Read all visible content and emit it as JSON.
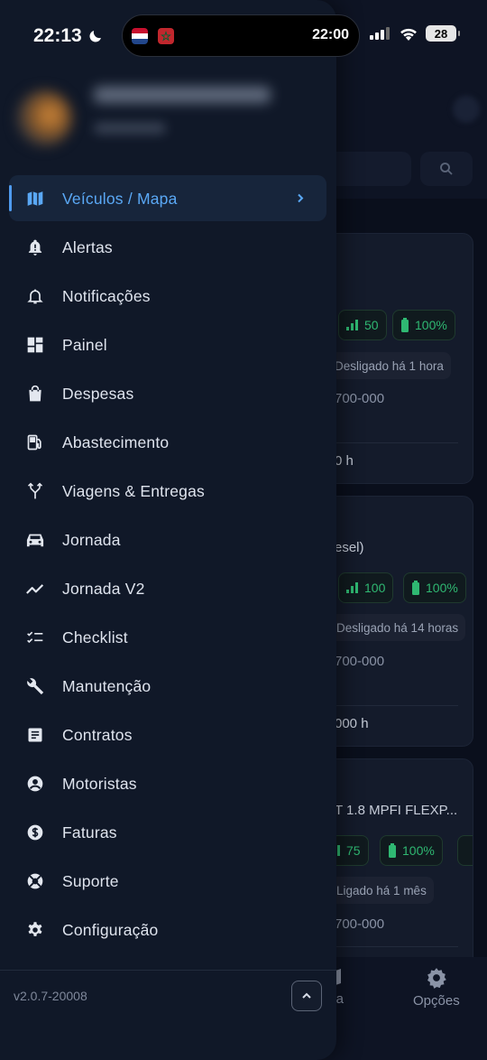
{
  "status_bar": {
    "time": "22:13",
    "island_time": "22:00",
    "battery": "28"
  },
  "drawer": {
    "menu": [
      {
        "label": "Veículos / Mapa",
        "icon": "map-icon",
        "active": true
      },
      {
        "label": "Alertas",
        "icon": "bell-alert-icon"
      },
      {
        "label": "Notificações",
        "icon": "bell-outline-icon"
      },
      {
        "label": "Painel",
        "icon": "dashboard-icon"
      },
      {
        "label": "Despesas",
        "icon": "shopping-bag-icon"
      },
      {
        "label": "Abastecimento",
        "icon": "fuel-pump-icon"
      },
      {
        "label": "Viagens & Entregas",
        "icon": "route-fork-icon"
      },
      {
        "label": "Jornada",
        "icon": "car-icon"
      },
      {
        "label": "Jornada V2",
        "icon": "trend-line-icon"
      },
      {
        "label": "Checklist",
        "icon": "checklist-icon"
      },
      {
        "label": "Manutenção",
        "icon": "wrench-icon"
      },
      {
        "label": "Contratos",
        "icon": "document-icon"
      },
      {
        "label": "Motoristas",
        "icon": "user-circle-icon"
      },
      {
        "label": "Faturas",
        "icon": "dollar-circle-icon"
      },
      {
        "label": "Suporte",
        "icon": "lifebuoy-icon"
      },
      {
        "label": "Configuração",
        "icon": "gear-icon"
      }
    ],
    "version": "v2.0.7-20008"
  },
  "background": {
    "cards": [
      {
        "signal": "50",
        "battery": "100%",
        "status": "Desligado há 1 hora",
        "odometer": "700-000",
        "hours": "0 h"
      },
      {
        "model": "esel)",
        "signal": "100",
        "battery": "100%",
        "status": "Desligado há 14 horas",
        "odometer": "700-000",
        "hours": "000 h"
      },
      {
        "model": "T 1.8 MPFI FLEXP...",
        "signal": "75",
        "battery": "100%",
        "status": "Ligado há 1 mês",
        "odometer": "700-000"
      }
    ],
    "bottom_nav": [
      {
        "label": "apa"
      },
      {
        "label": "Opções"
      }
    ]
  },
  "colors": {
    "drawer_bg": "#101828",
    "accent": "#5aa8f5",
    "active_bg": "#17253b",
    "green": "#2fb872"
  }
}
